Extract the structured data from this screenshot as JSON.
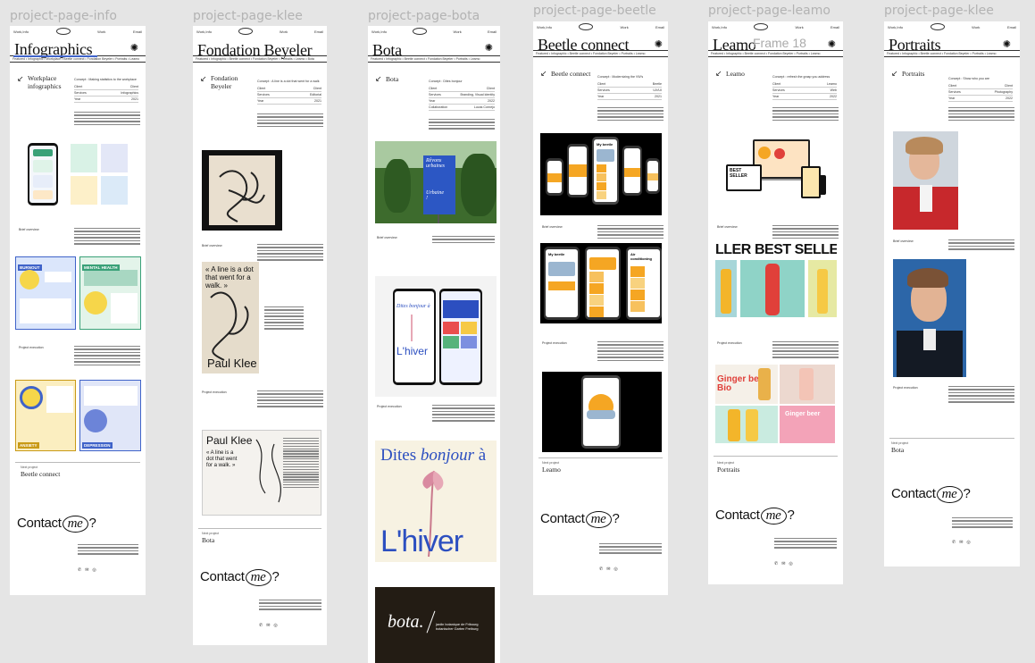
{
  "frames": [
    {
      "label": "project-page-info",
      "nav": [
        "Work,Info",
        "Iepoi",
        "Work",
        "Email"
      ],
      "title": "Infographics",
      "marquee": "Featured • Infographic • Workplace • Beetle connect • Fondation Beyeler • Portraits • Leamo",
      "subtitle": [
        "Workplace",
        "infographics"
      ],
      "concept": "Concept : Making statistics to the workplace",
      "meta": [
        [
          "Client",
          "Client"
        ],
        [
          "Services",
          "Infographics"
        ],
        [
          "Year",
          "2021"
        ]
      ],
      "section_labels": [
        "Brief overview",
        "Project execution"
      ],
      "infographic_texts": [
        "BURNOUT",
        "MENTAL HEALTH",
        "ANXIETY",
        "DEPRESSION"
      ],
      "next_label": "Next project",
      "next_title": "Beetle connect",
      "contact": {
        "before": "Contact",
        "me": "me",
        "after": "?"
      }
    },
    {
      "label": "project-page-klee",
      "nav": [
        "Work,Info",
        "Iepoi",
        "Work",
        "Email"
      ],
      "title": "Fondation Beyeler",
      "marquee": "Featured • Infographic • Beetle connect • Fondation Beyeler • Portraits • Leamo • Bota",
      "subtitle": [
        "Fondation",
        "Beyeler"
      ],
      "concept": "Concept : A line is a dot that went for a walk",
      "meta": [
        [
          "Client",
          "Client"
        ],
        [
          "Services",
          "Editorial"
        ],
        [
          "Year",
          "2021"
        ]
      ],
      "section_labels": [
        "Brief overview",
        "Project execution"
      ],
      "quote": "« A line is a dot that went for a walk. »",
      "quote_small": "« A line is a dot that went for a walk. »",
      "paul_klee": "Paul Klee",
      "next_label": "Next project",
      "next_title": "Bota",
      "contact": {
        "before": "Contact",
        "me": "me",
        "after": "?"
      }
    },
    {
      "label": "project-page-bota",
      "nav": [
        "Work,Info",
        "Iepoi",
        "Work",
        "Email"
      ],
      "title": "Bota",
      "marquee": "Featured • Infographic • Beetle connect • Fondation Beyeler • Portraits • Leamo",
      "subtitle": [
        "Bota"
      ],
      "concept": "Concept : Dites bonjour",
      "meta": [
        [
          "Client",
          "Client"
        ],
        [
          "Services",
          "Branding, Visual identity"
        ],
        [
          "Year",
          "2022"
        ],
        [
          "Collaboration",
          "Lucas Cornejo"
        ]
      ],
      "section_labels": [
        "Brief overview",
        "Project execution"
      ],
      "poster_texts": [
        "Rêvons",
        "urbaines",
        "Urbaine",
        "!"
      ],
      "phone_texts": [
        "Dites bonjour à",
        "L'hiver"
      ],
      "dites": "Dites",
      "bonjour": "bonjour",
      "a_char": "à",
      "lhiver": "L'hiver",
      "bota_logo": "bota.",
      "bota_sub": [
        "jardin botanique de Fribourg",
        "botanischer Garten Freiburg"
      ]
    },
    {
      "label": "project-page-beetle",
      "nav": [
        "Work,Info",
        "Iepoi",
        "Work",
        "Email"
      ],
      "title": "Beetle connect",
      "marquee": "Featured • Infographic • Beetle connect • Fondation Beyeler • Portraits • Leamo",
      "subtitle": [
        "Beetle connect"
      ],
      "concept": "Concept : Modernizing the VW's",
      "meta": [
        [
          "Client",
          "Beetle"
        ],
        [
          "Services",
          "UX/UI"
        ],
        [
          "Year",
          "2021"
        ]
      ],
      "section_labels": [
        "Brief overview",
        "Project execution"
      ],
      "app_texts": [
        "My beetle",
        "Air conditioning"
      ],
      "next_label": "Next project",
      "next_title": "Leamo",
      "contact": {
        "before": "Contact",
        "me": "me",
        "after": "?"
      }
    },
    {
      "label": "project-page-leamo",
      "nav": [
        "Work,Info",
        "Iepoi",
        "Work",
        "Email"
      ],
      "title": "Leamo",
      "title_ghost": "Frame 18",
      "marquee": "Featured • Infographic • Beetle connect • Fondation Beyeler • Portraits • Leamo",
      "subtitle": [
        "Leamo"
      ],
      "concept": "Concept : refresh the grasp you address",
      "meta": [
        [
          "Client",
          "Leamo"
        ],
        [
          "Services",
          "Web"
        ],
        [
          "Year",
          "2022"
        ]
      ],
      "section_labels": [
        "Brief overview",
        "Project execution"
      ],
      "best_seller": "BEST SELLER",
      "ller": "LLER",
      "ginger": "Ginger beer",
      "bio": "Bio",
      "next_label": "Next project",
      "next_title": "Portraits",
      "contact": {
        "before": "Contact",
        "me": "me",
        "after": "?"
      }
    },
    {
      "label": "project-page-klee",
      "nav": [
        "Work,Info",
        "Iepoi",
        "Work",
        "Email"
      ],
      "title": "Portraits",
      "marquee": "Featured • Infographic • Beetle connect • Fondation Beyeler • Portraits • Leamo",
      "subtitle": [
        "Portraits"
      ],
      "concept": "Concept : Show who you are",
      "meta": [
        [
          "Client",
          "Client"
        ],
        [
          "Services",
          "Photography"
        ],
        [
          "Year",
          "2022"
        ]
      ],
      "section_labels": [
        "Brief overview",
        "Project execution"
      ],
      "next_label": "Next project",
      "next_title": "Bota",
      "contact": {
        "before": "Contact",
        "me": "me",
        "after": "?"
      }
    }
  ],
  "icons": [
    "phone-icon",
    "mail-icon",
    "instagram-icon"
  ],
  "colors": {
    "canvas": "#e5e5e5",
    "frame": "#ffffff",
    "label": "#b3b3b3",
    "info_blue": "#3f63c9",
    "info_green": "#3aa178",
    "bota_blue": "#2c4fc0",
    "beetle_orange": "#f5a623",
    "leamo_red": "#e0403a"
  }
}
